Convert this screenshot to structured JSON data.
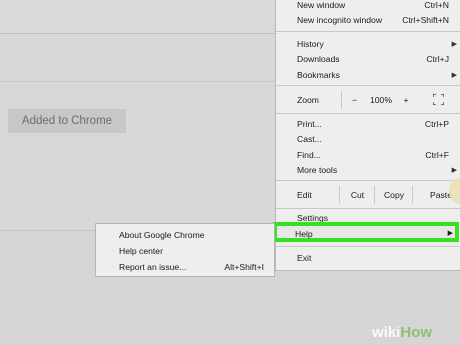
{
  "background": {
    "added_button_label": "Added to Chrome"
  },
  "menu": {
    "new_window": {
      "label": "New window",
      "shortcut": "Ctrl+N"
    },
    "new_incognito": {
      "label": "New incognito window",
      "shortcut": "Ctrl+Shift+N"
    },
    "history": {
      "label": "History"
    },
    "downloads": {
      "label": "Downloads",
      "shortcut": "Ctrl+J"
    },
    "bookmarks": {
      "label": "Bookmarks"
    },
    "zoom": {
      "label": "Zoom",
      "minus": "−",
      "value": "100%",
      "plus": "+"
    },
    "print": {
      "label": "Print...",
      "shortcut": "Ctrl+P"
    },
    "cast": {
      "label": "Cast..."
    },
    "find": {
      "label": "Find...",
      "shortcut": "Ctrl+F"
    },
    "more_tools": {
      "label": "More tools"
    },
    "edit": {
      "label": "Edit",
      "cut": "Cut",
      "copy": "Copy",
      "paste": "Paste"
    },
    "settings": {
      "label": "Settings"
    },
    "help": {
      "label": "Help"
    },
    "exit": {
      "label": "Exit"
    }
  },
  "help_submenu": {
    "about": {
      "label": "About Google Chrome"
    },
    "help_center": {
      "label": "Help center"
    },
    "report": {
      "label": "Report an issue...",
      "shortcut": "Alt+Shift+I"
    }
  },
  "watermark": {
    "part1": "wiki",
    "part2": "How"
  },
  "colors": {
    "highlight": "#36e020",
    "menu_bg": "#eeeeee"
  }
}
